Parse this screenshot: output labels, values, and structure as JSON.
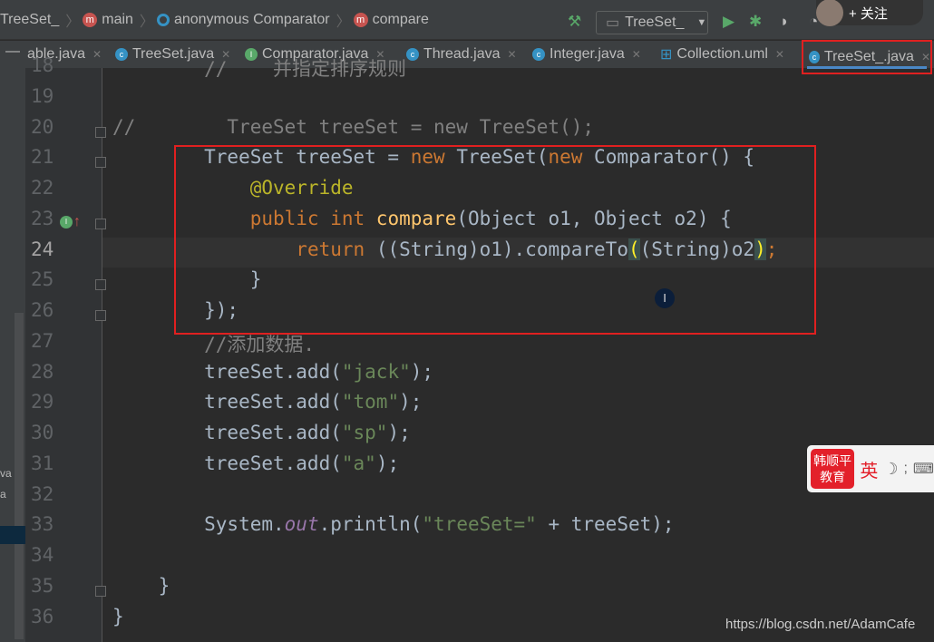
{
  "breadcrumb": [
    "TreeSet_",
    "main",
    "anonymous Comparator",
    "compare"
  ],
  "run_config": "TreeSet_",
  "follow_label": "+ 关注",
  "tabs": [
    {
      "label": "able.java",
      "icon": "none"
    },
    {
      "label": "TreeSet.java",
      "icon": "class"
    },
    {
      "label": "Comparator.java",
      "icon": "interface"
    },
    {
      "label": "Thread.java",
      "icon": "class"
    },
    {
      "label": "Integer.java",
      "icon": "class"
    },
    {
      "label": "Collection.uml",
      "icon": "uml"
    },
    {
      "label": "TreeSet_.java",
      "icon": "class",
      "active": true
    }
  ],
  "left_panel": [
    "va",
    "a"
  ],
  "lines": [
    {
      "n": "18",
      "t": [
        [
          "        //    并指定排序规则",
          "cm"
        ]
      ]
    },
    {
      "n": "19",
      "t": []
    },
    {
      "n": "20",
      "t": [
        [
          "//        TreeSet treeSet = new TreeSet();",
          "cm"
        ]
      ]
    },
    {
      "n": "21",
      "t": [
        [
          "        TreeSet treeSet = ",
          ""
        ],
        [
          "new ",
          "kw"
        ],
        [
          "TreeSet(",
          ""
        ],
        [
          "new ",
          "kw"
        ],
        [
          "Comparator() {",
          ""
        ]
      ]
    },
    {
      "n": "22",
      "t": [
        [
          "            ",
          ""
        ],
        [
          "@Override",
          "ann"
        ]
      ]
    },
    {
      "n": "23",
      "t": [
        [
          "            ",
          ""
        ],
        [
          "public int ",
          "kw"
        ],
        [
          "compare",
          "fn"
        ],
        [
          "(Object o1, Object o2) {",
          ""
        ]
      ]
    },
    {
      "n": "24",
      "t": [
        [
          "                ",
          ""
        ],
        [
          "return ",
          "kw"
        ],
        [
          "((String)o1).compareTo",
          ""
        ],
        [
          "(",
          "br"
        ],
        [
          "(String)o2",
          ""
        ],
        [
          ")",
          "br"
        ],
        [
          ";",
          "kw"
        ]
      ]
    },
    {
      "n": "25",
      "t": [
        [
          "            }",
          ""
        ]
      ]
    },
    {
      "n": "26",
      "t": [
        [
          "        });",
          ""
        ]
      ]
    },
    {
      "n": "27",
      "t": [
        [
          "        //添加数据.",
          "cm"
        ]
      ]
    },
    {
      "n": "28",
      "t": [
        [
          "        treeSet.add(",
          ""
        ],
        [
          "\"jack\"",
          "str"
        ],
        [
          ");",
          ""
        ]
      ]
    },
    {
      "n": "29",
      "t": [
        [
          "        treeSet.add(",
          ""
        ],
        [
          "\"tom\"",
          "str"
        ],
        [
          ");",
          ""
        ]
      ]
    },
    {
      "n": "30",
      "t": [
        [
          "        treeSet.add(",
          ""
        ],
        [
          "\"sp\"",
          "str"
        ],
        [
          ");",
          ""
        ]
      ]
    },
    {
      "n": "31",
      "t": [
        [
          "        treeSet.add(",
          ""
        ],
        [
          "\"a\"",
          "str"
        ],
        [
          ");",
          ""
        ]
      ]
    },
    {
      "n": "32",
      "t": []
    },
    {
      "n": "33",
      "t": [
        [
          "        System.",
          ""
        ],
        [
          "out",
          "st"
        ],
        [
          ".println(",
          ""
        ],
        [
          "\"treeSet=\"",
          "str"
        ],
        [
          " + treeSet);",
          ""
        ]
      ]
    },
    {
      "n": "34",
      "t": []
    },
    {
      "n": "35",
      "t": [
        [
          "    }",
          ""
        ]
      ]
    },
    {
      "n": "36",
      "t": [
        [
          "}",
          ""
        ]
      ]
    }
  ],
  "current_line": "24",
  "ime": {
    "logo": "韩顺平 教育",
    "lang": "英"
  },
  "watermark": "https://blog.csdn.net/AdamCafe",
  "colors": {
    "highlight_box": "#e02020",
    "background": "#2b2b2b"
  }
}
